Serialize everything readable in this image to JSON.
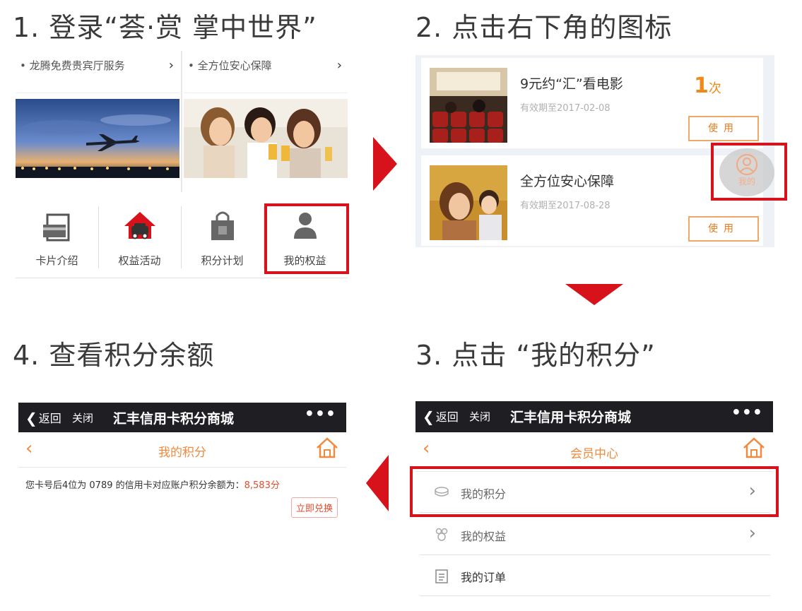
{
  "steps": {
    "step1": "1. 登录“荟·赏 掌中世界”",
    "step2": "2. 点击右下角的图标",
    "step3": "3. 点击 “我的积分”",
    "step4": "4. 查看积分余额"
  },
  "panel1": {
    "promos": [
      {
        "label": "• 龙腾免费贵宾厅服务",
        "chevron": "›"
      },
      {
        "label": "• 全方位安心保障",
        "chevron": "›"
      }
    ],
    "icons": [
      {
        "label": "卡片介绍",
        "icon": "card-icon"
      },
      {
        "label": "权益活动",
        "icon": "house-car-icon"
      },
      {
        "label": "积分计划",
        "icon": "shopping-bag-icon"
      },
      {
        "label": "我的权益",
        "icon": "person-icon"
      }
    ]
  },
  "panel2": {
    "coupons": [
      {
        "name": "9元约“汇”看电影",
        "valid": "有效期至2017-02-08",
        "count": "1",
        "count_unit": "次",
        "use": "使用"
      },
      {
        "name": "全方位安心保障",
        "valid": "有效期至2017-08-28",
        "use": "使用"
      }
    ],
    "float_label": "我的"
  },
  "panel3": {
    "nav": {
      "back": "返回",
      "close": "关闭",
      "title": "汇丰信用卡积分商城",
      "more": "•••"
    },
    "sub_title": "会员中心",
    "menu": [
      {
        "label": "我的积分",
        "icon": "points-icon"
      },
      {
        "label": "我的权益",
        "icon": "gift-icon"
      },
      {
        "label": "我的订单",
        "icon": "order-icon"
      }
    ]
  },
  "panel4": {
    "nav": {
      "back": "返回",
      "close": "关闭",
      "title": "汇丰信用卡积分商城",
      "more": "•••"
    },
    "sub_title": "我的积分",
    "points_text": "您卡号后4位为 0789 的信用卡对应账户积分余额为：",
    "points_value": "8,583分",
    "redeem": "立即兑换"
  },
  "colors": {
    "accent_red": "#d8121a",
    "orange": "#f08a3e",
    "dark_nav": "#1f1f23"
  }
}
